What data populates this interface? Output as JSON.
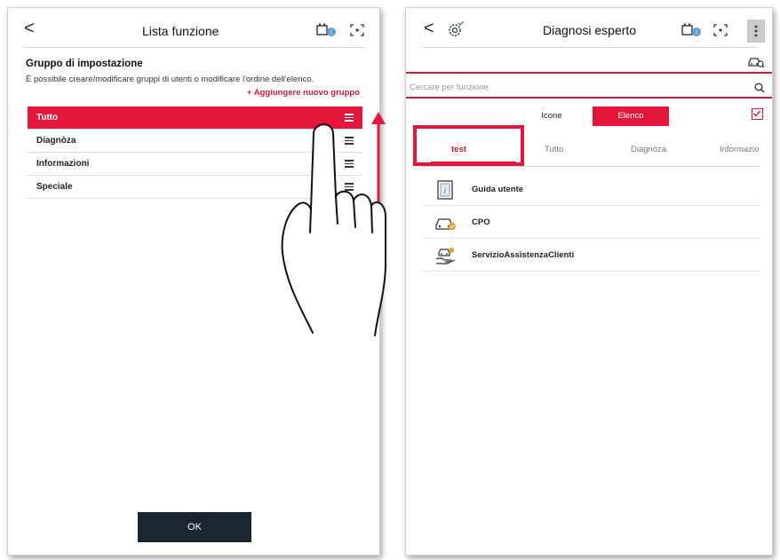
{
  "left": {
    "title": "Lista funzione",
    "back_glyph": "<",
    "icons": [
      "car-battery-icon",
      "fullscreen-icon"
    ],
    "group_title": "Gruppo di impostazione",
    "group_desc": "È possibile creare/modificare gruppi di utenti o modificare l'ordine dell'elenco.",
    "add_group": "+ Aggiungere nuovo gruppo",
    "items": [
      {
        "label": "Tutto",
        "active": true
      },
      {
        "label": "Diagnòza",
        "active": false
      },
      {
        "label": "Informazioni",
        "active": false
      },
      {
        "label": "Speciale",
        "active": false
      }
    ],
    "ok_label": "OK"
  },
  "right": {
    "title": "Diagnosi esperto",
    "back_glyph": "<",
    "icons": [
      "gear-car-icon",
      "car-battery-icon",
      "fullscreen-icon",
      "more-vert-icon",
      "car-search-icon"
    ],
    "search_placeholder": "Cercare per funzione",
    "view_toggle": {
      "icone": "Icone",
      "elenco": "Elenco",
      "selected": "Elenco"
    },
    "tabs": [
      {
        "label": "test",
        "active": true
      },
      {
        "label": "Tutto",
        "active": false
      },
      {
        "label": "Diagnòza",
        "active": false
      },
      {
        "label": "Informazio",
        "active": false
      }
    ],
    "menu": [
      {
        "label": "Guida utente",
        "icon": "info-book-icon"
      },
      {
        "label": "CPO",
        "icon": "car-certified-icon"
      },
      {
        "label": "ServizioAssistenzaClienti",
        "icon": "customer-service-icon"
      }
    ]
  },
  "colors": {
    "accent": "#e5163c",
    "dark_button": "#1a2530"
  }
}
